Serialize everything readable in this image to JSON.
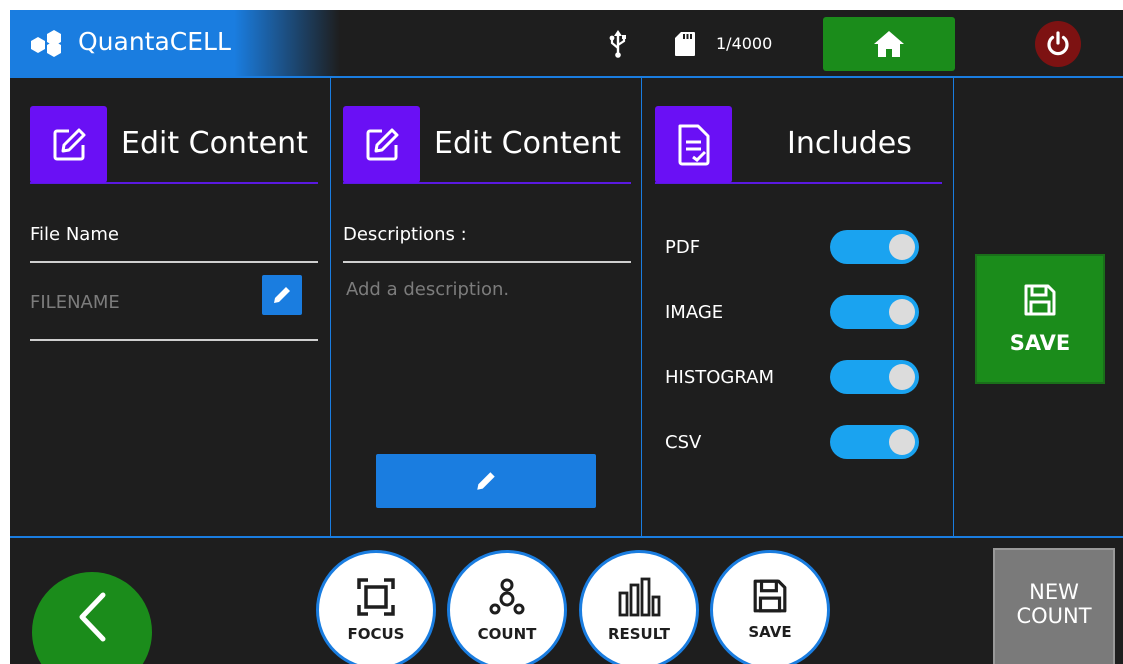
{
  "header": {
    "app_name": "QuantaCELL",
    "counter": "1/4000"
  },
  "panels": {
    "file": {
      "title": "Edit Content",
      "field_label": "File Name",
      "field_placeholder": "FILENAME"
    },
    "description": {
      "title": "Edit Content",
      "field_label": "Descriptions :",
      "field_placeholder": "Add a description."
    },
    "includes": {
      "title": "Includes",
      "items": [
        {
          "label": "PDF",
          "enabled": true
        },
        {
          "label": "IMAGE",
          "enabled": true
        },
        {
          "label": "HISTOGRAM",
          "enabled": true
        },
        {
          "label": "CSV",
          "enabled": true
        }
      ]
    },
    "save": {
      "label": "SAVE"
    }
  },
  "bottom_nav": {
    "items": [
      {
        "label": "FOCUS",
        "icon": "focus-icon"
      },
      {
        "label": "COUNT",
        "icon": "count-icon"
      },
      {
        "label": "RESULT",
        "icon": "result-icon"
      },
      {
        "label": "SAVE",
        "icon": "save-icon"
      }
    ],
    "new_count_line1": "NEW",
    "new_count_line2": "COUNT"
  },
  "colors": {
    "accent_blue": "#1a7de0",
    "purple": "#6a10f5",
    "green": "#1b8c1b",
    "power_red": "#7d1212",
    "toggle_on": "#1aa3f0"
  }
}
